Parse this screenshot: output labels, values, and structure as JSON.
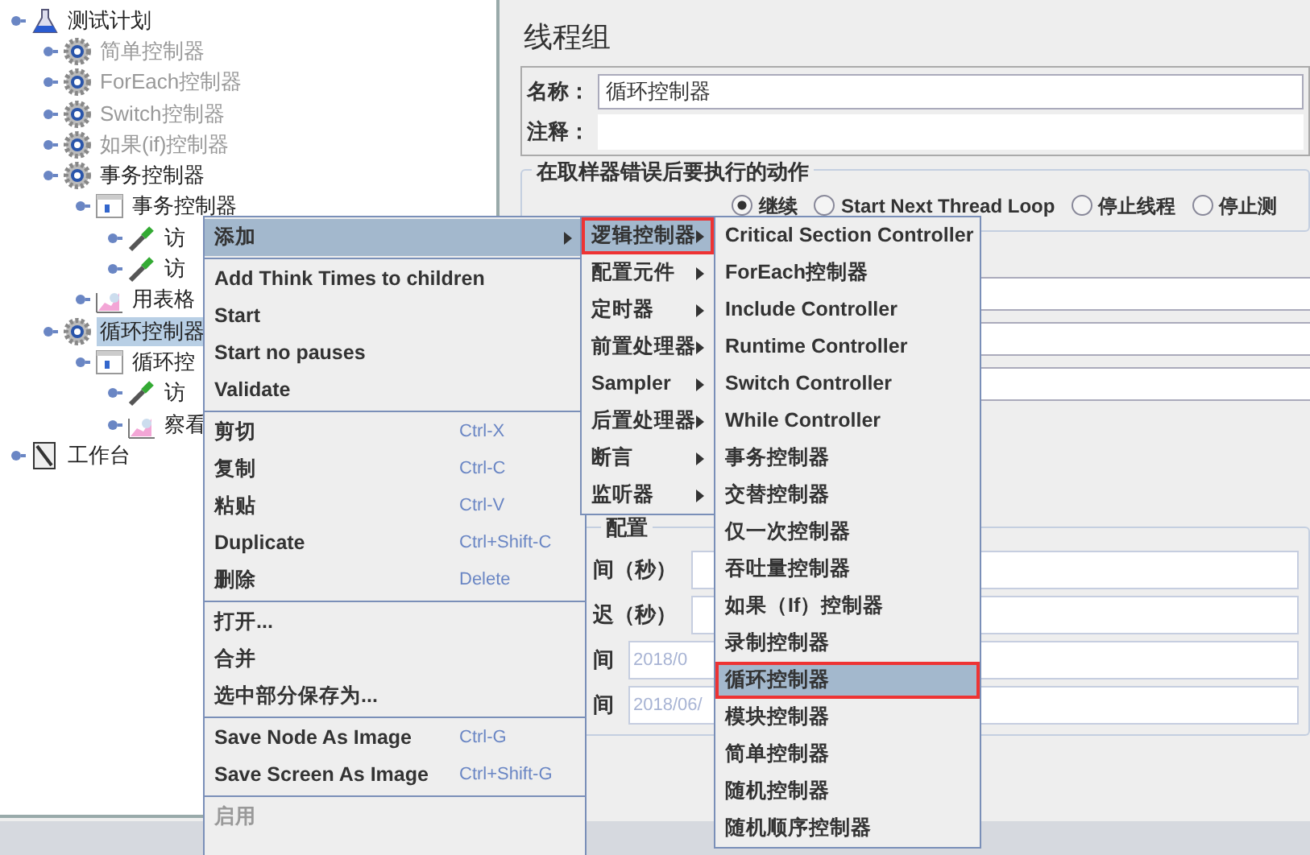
{
  "tree": [
    {
      "label": "测试计划",
      "kind": "plan",
      "selected": false,
      "disabled": false,
      "children": [
        {
          "label": "简单控制器",
          "kind": "gear",
          "selected": false,
          "disabled": true
        },
        {
          "label": "ForEach控制器",
          "kind": "gear",
          "selected": false,
          "disabled": true
        },
        {
          "label": "Switch控制器",
          "kind": "gear",
          "selected": false,
          "disabled": true
        },
        {
          "label": "如果(if)控制器",
          "kind": "gear",
          "selected": false,
          "disabled": true
        },
        {
          "label": "事务控制器",
          "kind": "gear",
          "selected": false,
          "disabled": false,
          "children": [
            {
              "label": "事务控制器",
              "kind": "controller",
              "selected": false,
              "disabled": false,
              "children": [
                {
                  "label": "访",
                  "kind": "sampler",
                  "selected": false,
                  "disabled": false
                },
                {
                  "label": "访",
                  "kind": "sampler",
                  "selected": false,
                  "disabled": false
                }
              ]
            },
            {
              "label": "用表格",
              "kind": "listener",
              "selected": false,
              "disabled": false
            }
          ]
        },
        {
          "label": "循环控制器",
          "kind": "gear",
          "selected": true,
          "disabled": false,
          "children": [
            {
              "label": "循环控",
              "kind": "controller",
              "selected": false,
              "disabled": false,
              "children": [
                {
                  "label": "访",
                  "kind": "sampler",
                  "selected": false,
                  "disabled": false
                },
                {
                  "label": "察看",
                  "kind": "listener",
                  "selected": false,
                  "disabled": false
                }
              ]
            }
          ]
        }
      ]
    },
    {
      "label": "工作台",
      "kind": "workbench",
      "selected": false,
      "disabled": false
    }
  ],
  "panel": {
    "title": "线程组",
    "name_label": "名称：",
    "name_value": "循环控制器",
    "comment_label": "注释：",
    "error_action": {
      "legend": "在取样器错误后要执行的动作",
      "options": [
        {
          "label": "继续",
          "selected": true
        },
        {
          "label": "Start Next Thread Loop",
          "selected": false
        },
        {
          "label": "停止线程",
          "selected": false
        },
        {
          "label": "停止测",
          "selected": false
        }
      ]
    },
    "scheduler": {
      "legend": "配置",
      "rows": [
        {
          "label": "间（秒）"
        },
        {
          "label": "迟（秒）"
        },
        {
          "label": "间",
          "value": "2018/0"
        },
        {
          "label": "间",
          "value": "2018/06/"
        }
      ]
    }
  },
  "context_menu": {
    "groups": [
      [
        {
          "label": "添加",
          "selected": true,
          "disabled": false,
          "has_submenu": true
        }
      ],
      [
        {
          "label": "Add Think Times to children",
          "selected": false,
          "disabled": false,
          "has_submenu": false
        },
        {
          "label": "Start",
          "selected": false,
          "disabled": false,
          "has_submenu": false
        },
        {
          "label": "Start no pauses",
          "selected": false,
          "disabled": false,
          "has_submenu": false
        },
        {
          "label": "Validate",
          "selected": false,
          "disabled": false,
          "has_submenu": false
        }
      ],
      [
        {
          "label": "剪切",
          "shortcut": "Ctrl-X",
          "selected": false,
          "disabled": false,
          "has_submenu": false
        },
        {
          "label": "复制",
          "shortcut": "Ctrl-C",
          "selected": false,
          "disabled": false,
          "has_submenu": false
        },
        {
          "label": "粘贴",
          "shortcut": "Ctrl-V",
          "selected": false,
          "disabled": false,
          "has_submenu": false
        },
        {
          "label": "Duplicate",
          "shortcut": "Ctrl+Shift-C",
          "selected": false,
          "disabled": false,
          "has_submenu": false
        },
        {
          "label": "删除",
          "shortcut": "Delete",
          "selected": false,
          "disabled": false,
          "has_submenu": false
        }
      ],
      [
        {
          "label": "打开...",
          "selected": false,
          "disabled": false,
          "has_submenu": false
        },
        {
          "label": "合并",
          "selected": false,
          "disabled": false,
          "has_submenu": false
        },
        {
          "label": "选中部分保存为...",
          "selected": false,
          "disabled": false,
          "has_submenu": false
        }
      ],
      [
        {
          "label": "Save Node As Image",
          "shortcut": "Ctrl-G",
          "selected": false,
          "disabled": false,
          "has_submenu": false
        },
        {
          "label": "Save Screen As Image",
          "shortcut": "Ctrl+Shift-G",
          "selected": false,
          "disabled": false,
          "has_submenu": false
        }
      ],
      [
        {
          "label": "启用",
          "selected": false,
          "disabled": true,
          "has_submenu": false
        }
      ]
    ]
  },
  "add_submenu": [
    {
      "label": "逻辑控制器",
      "selected": true,
      "annotated": true
    },
    {
      "label": "配置元件",
      "selected": false,
      "annotated": false
    },
    {
      "label": "定时器",
      "selected": false,
      "annotated": false
    },
    {
      "label": "前置处理器",
      "selected": false,
      "annotated": false
    },
    {
      "label": "Sampler",
      "selected": false,
      "annotated": false
    },
    {
      "label": "后置处理器",
      "selected": false,
      "annotated": false
    },
    {
      "label": "断言",
      "selected": false,
      "annotated": false
    },
    {
      "label": "监听器",
      "selected": false,
      "annotated": false
    }
  ],
  "logic_submenu": [
    {
      "label": "Critical Section Controller",
      "selected": false,
      "annotated": false
    },
    {
      "label": "ForEach控制器",
      "selected": false,
      "annotated": false
    },
    {
      "label": "Include Controller",
      "selected": false,
      "annotated": false
    },
    {
      "label": "Runtime Controller",
      "selected": false,
      "annotated": false
    },
    {
      "label": "Switch Controller",
      "selected": false,
      "annotated": false
    },
    {
      "label": "While Controller",
      "selected": false,
      "annotated": false
    },
    {
      "label": "事务控制器",
      "selected": false,
      "annotated": false
    },
    {
      "label": "交替控制器",
      "selected": false,
      "annotated": false
    },
    {
      "label": "仅一次控制器",
      "selected": false,
      "annotated": false
    },
    {
      "label": "吞吐量控制器",
      "selected": false,
      "annotated": false
    },
    {
      "label": "如果（If）控制器",
      "selected": false,
      "annotated": false
    },
    {
      "label": "录制控制器",
      "selected": false,
      "annotated": false
    },
    {
      "label": "循环控制器",
      "selected": true,
      "annotated": true
    },
    {
      "label": "模块控制器",
      "selected": false,
      "annotated": false
    },
    {
      "label": "简单控制器",
      "selected": false,
      "annotated": false
    },
    {
      "label": "随机控制器",
      "selected": false,
      "annotated": false
    },
    {
      "label": "随机顺序控制器",
      "selected": false,
      "annotated": false
    }
  ]
}
